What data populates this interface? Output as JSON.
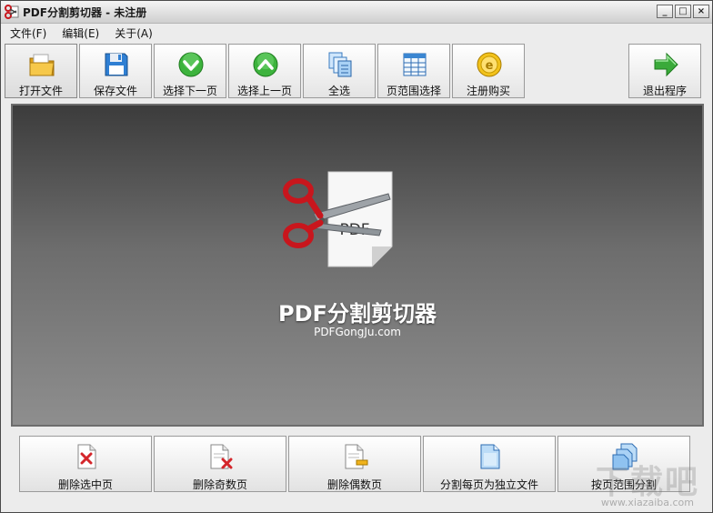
{
  "window": {
    "title": "PDF分割剪切器 - 未注册",
    "controls": {
      "minimize": "_",
      "maximize": "□",
      "close": "×"
    }
  },
  "menu": [
    "文件(F)",
    "编辑(E)",
    "关于(A)"
  ],
  "toolbar": {
    "buttons": [
      {
        "label": "打开文件",
        "icon": "folder-icon"
      },
      {
        "label": "保存文件",
        "icon": "floppy-disk-icon"
      },
      {
        "label": "选择下一页",
        "icon": "green-down-arrow-icon"
      },
      {
        "label": "选择上一页",
        "icon": "green-up-arrow-icon"
      },
      {
        "label": "全选",
        "icon": "stacked-pages-icon"
      },
      {
        "label": "页范围选择",
        "icon": "grid-sheet-icon"
      },
      {
        "label": "注册购买",
        "icon": "gold-coin-icon"
      },
      {
        "label": "退出程序",
        "icon": "green-right-arrow-icon"
      }
    ]
  },
  "stage": {
    "logo_text": "PDF",
    "title": "PDF分割剪切器",
    "subtitle": "PDFGongJu.com"
  },
  "bottom": {
    "buttons": [
      {
        "label": "删除选中页",
        "icon": "page-delete-icon"
      },
      {
        "label": "删除奇数页",
        "icon": "page-delete-red-icon"
      },
      {
        "label": "删除偶数页",
        "icon": "page-minus-icon"
      },
      {
        "label": "分割每页为独立文件",
        "icon": "blue-page-icon"
      },
      {
        "label": "按页范围分割",
        "icon": "blue-pages-stack-icon"
      }
    ]
  },
  "watermark": {
    "text": "下载吧",
    "url": "www.xiazaiba.com"
  },
  "colors": {
    "accent_green": "#2fa52f",
    "stage_dark": "#3c3c3c",
    "scissor_red": "#c8161d"
  }
}
